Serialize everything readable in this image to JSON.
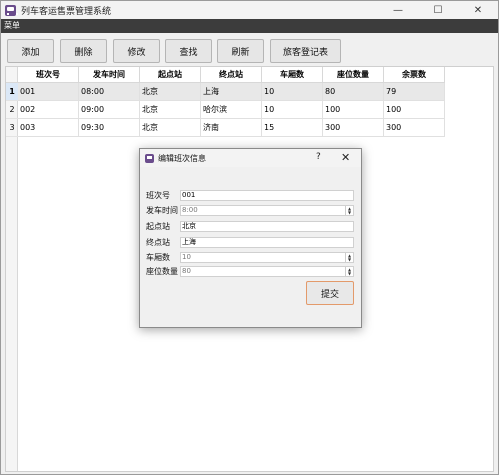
{
  "window": {
    "title": "列车客运售票管理系统",
    "controls": {
      "minimize": "—",
      "maximize": "☐",
      "close": "✕"
    }
  },
  "menubar": {
    "label": "菜单"
  },
  "toolbar": {
    "buttons": [
      "添加",
      "删除",
      "修改",
      "查找",
      "刷新",
      "旅客登记表"
    ]
  },
  "table": {
    "columns": [
      "班次号",
      "发车时间",
      "起点站",
      "终点站",
      "车厢数",
      "座位数量",
      "余票数"
    ],
    "rows": [
      [
        "001",
        "08:00",
        "北京",
        "上海",
        "10",
        "80",
        "79"
      ],
      [
        "002",
        "09:00",
        "北京",
        "哈尔滨",
        "10",
        "100",
        "100"
      ],
      [
        "003",
        "09:30",
        "北京",
        "济南",
        "15",
        "300",
        "300"
      ]
    ],
    "row_numbers": [
      "1",
      "2",
      "3"
    ]
  },
  "dialog": {
    "title": "编辑班次信息",
    "help": "?",
    "close": "✕",
    "fields": [
      {
        "label": "班次号",
        "value": "001"
      },
      {
        "label": "发车时间",
        "value": "8:00"
      },
      {
        "label": "起点站",
        "value": "北京"
      },
      {
        "label": "终点站",
        "value": "上海"
      },
      {
        "label": "车厢数",
        "value": "10"
      },
      {
        "label": "座位数量",
        "value": "80"
      }
    ],
    "submit_label": "提交"
  },
  "colors": {
    "menubar": "#3c3c3c",
    "app_icon": "#6a4c8c",
    "submit_border": "#e39a6a",
    "selected_row": "#dbe8f7"
  }
}
